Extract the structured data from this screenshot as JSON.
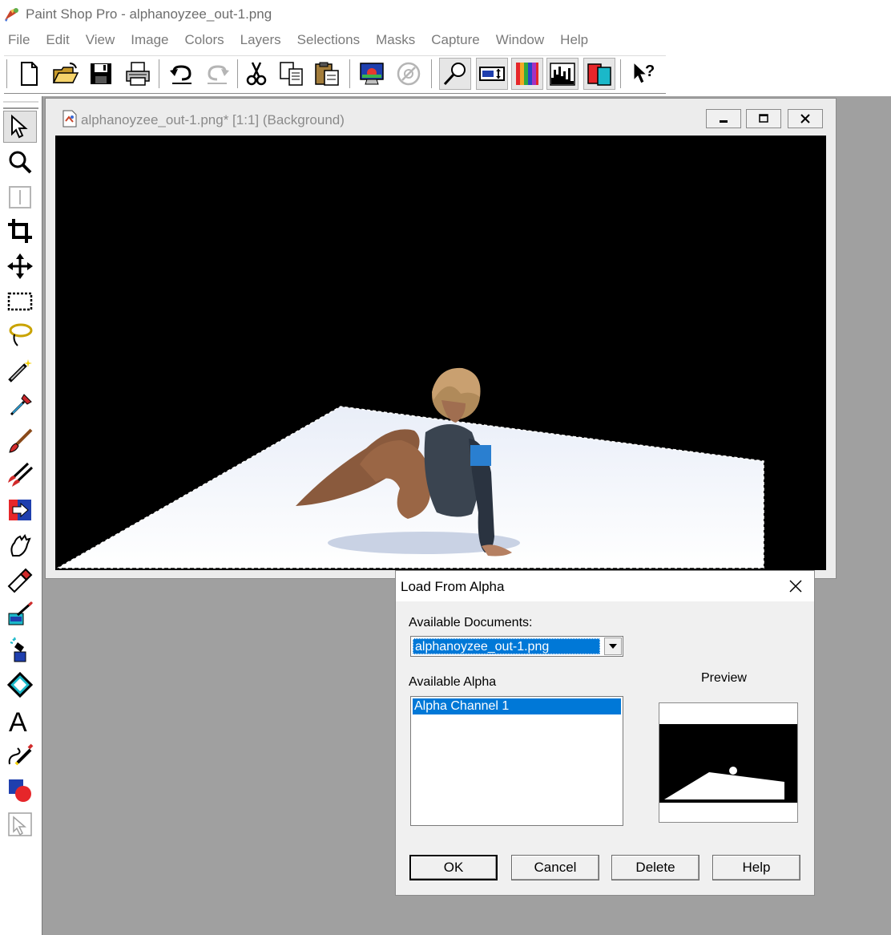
{
  "window": {
    "title": "Paint Shop Pro - alphanoyzee_out-1.png"
  },
  "menu": [
    "File",
    "Edit",
    "View",
    "Image",
    "Colors",
    "Layers",
    "Selections",
    "Masks",
    "Capture",
    "Window",
    "Help"
  ],
  "toolbar": {
    "buttons": [
      "new-document-icon",
      "open-folder-icon",
      "save-disk-icon",
      "print-icon",
      "undo-icon",
      "redo-icon",
      "cut-scissors-icon",
      "copy-icon",
      "paste-icon",
      "full-screen-preview-icon",
      "normal-viewing-icon",
      "tool-palette-toggle-icon",
      "tool-options-toggle-icon",
      "color-palette-toggle-icon",
      "histogram-toggle-icon",
      "layer-palette-toggle-icon",
      "context-help-icon"
    ]
  },
  "tools": [
    "arrow-tool-icon",
    "zoom-tool-icon",
    "deformation-tool-icon",
    "crop-tool-icon",
    "mover-tool-icon",
    "selection-tool-icon",
    "freehand-lasso-icon",
    "magic-wand-icon",
    "dropper-tool-icon",
    "paint-brush-icon",
    "clone-brush-icon",
    "color-replacer-icon",
    "retouch-tool-icon",
    "eraser-tool-icon",
    "picture-tube-icon",
    "airbrush-icon",
    "flood-fill-icon",
    "text-tool-icon",
    "draw-tool-icon",
    "preset-shapes-icon",
    "object-selector-icon"
  ],
  "image_window": {
    "title": "alphanoyzee_out-1.png* [1:1] (Background)"
  },
  "dialog": {
    "title": "Load From Alpha",
    "available_documents_label": "Available Documents:",
    "selected_document": "alphanoyzee_out-1.png",
    "available_alpha_label": "Available Alpha",
    "alpha_items": [
      "Alpha Channel 1"
    ],
    "preview_label": "Preview",
    "buttons": {
      "ok": "OK",
      "cancel": "Cancel",
      "delete": "Delete",
      "help": "Help"
    }
  },
  "colors": {
    "selection_blue": "#0078d7",
    "workspace_gray": "#a0a0a0",
    "dialog_bg": "#f0f0f0"
  }
}
